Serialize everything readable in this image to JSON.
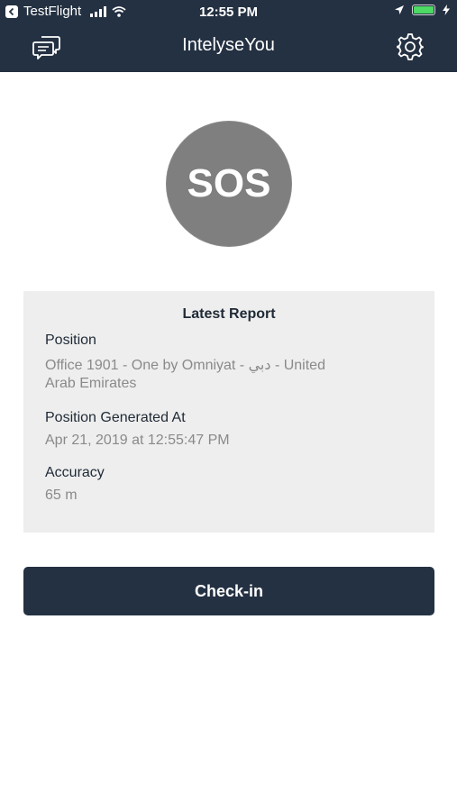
{
  "status_bar": {
    "back_app": "TestFlight",
    "time": "12:55 PM"
  },
  "navbar": {
    "title": "IntelyseYou",
    "left_icon": "chat-bubbles-icon",
    "right_icon": "gear-icon"
  },
  "sos": {
    "label": "SOS",
    "color": "#7f7f7f"
  },
  "report": {
    "title": "Latest Report",
    "position_label": "Position",
    "position_value_line1": "Office 1901 - One by Omniyat - دبي - United",
    "position_value_line2": "Arab Emirates",
    "generated_label": "Position Generated At",
    "generated_value": "Apr 21, 2019 at 12:55:47 PM",
    "accuracy_label": "Accuracy",
    "accuracy_value": "65 m"
  },
  "checkin": {
    "label": "Check-in"
  },
  "colors": {
    "primary": "#243142",
    "card_bg": "#eeeeee",
    "battery": "#4cd964"
  }
}
